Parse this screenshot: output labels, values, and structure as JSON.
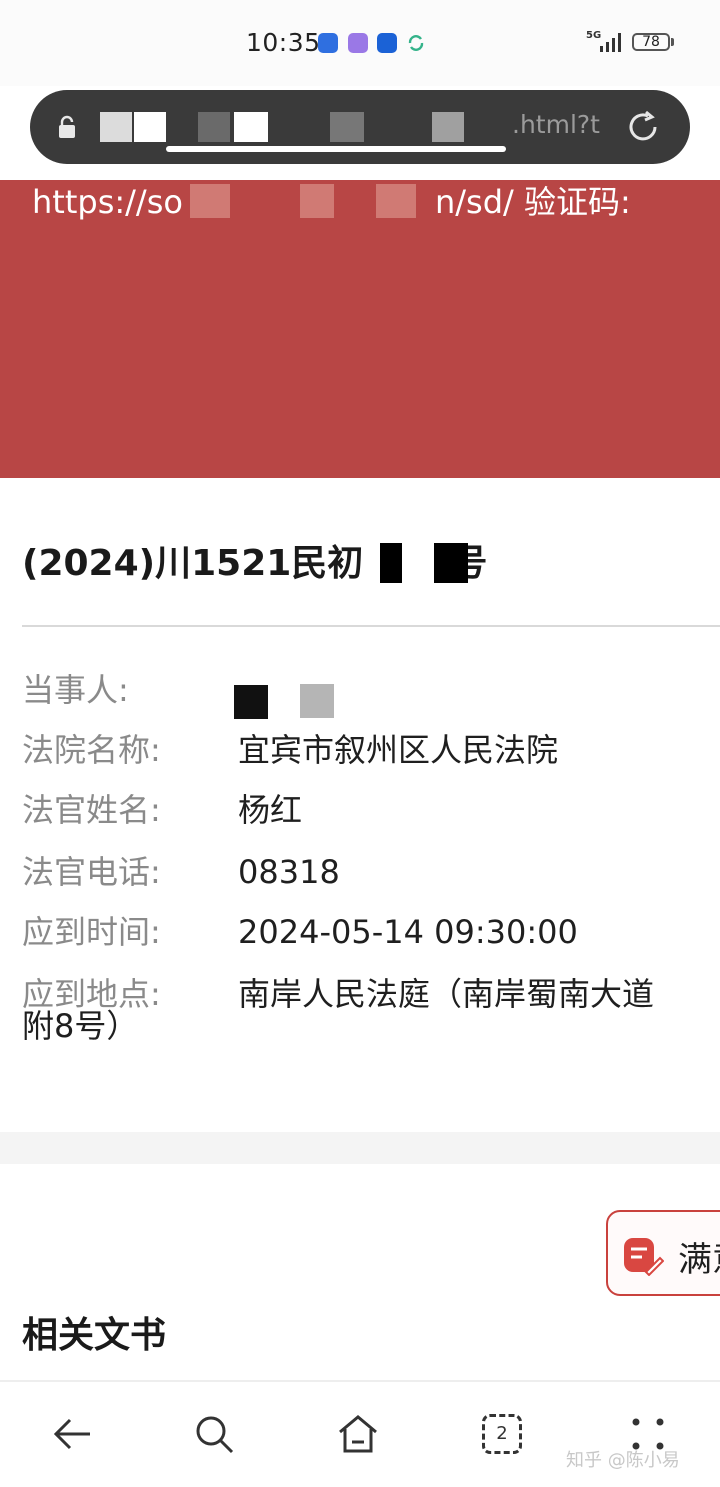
{
  "status_bar": {
    "time": "10:35",
    "signal_label": "5G",
    "battery": "78"
  },
  "url_bar": {
    "visible_url_fragment": ".html?t"
  },
  "banner": {
    "url_prefix": "https://so",
    "url_middle": "n/sd/",
    "verification_label": "验证码:",
    "color": "#b84645"
  },
  "case": {
    "case_number_prefix": "(2024)川1521民初",
    "case_number_suffix": "号",
    "fields": [
      {
        "label": "当事人:",
        "value": ""
      },
      {
        "label": "法院名称:",
        "value": "宜宾市叙州区人民法院"
      },
      {
        "label": "法官姓名:",
        "value": "杨红"
      },
      {
        "label": "法官电话:",
        "value": "08318"
      },
      {
        "label": "应到时间:",
        "value": "2024-05-14 09:30:00"
      },
      {
        "label": "应到地点:",
        "value": "南岸人民法庭（南岸蜀南大道"
      }
    ],
    "location_wrap": "附8号）"
  },
  "floating_button": {
    "label": "满意"
  },
  "related_docs": {
    "title": "相关文书"
  },
  "bottom_nav": {
    "tab_count": "2",
    "watermark": "知乎 @陈小易",
    "icons": [
      "back-arrow-icon",
      "search-icon",
      "home-icon",
      "tabs-icon",
      "more-icon"
    ]
  }
}
